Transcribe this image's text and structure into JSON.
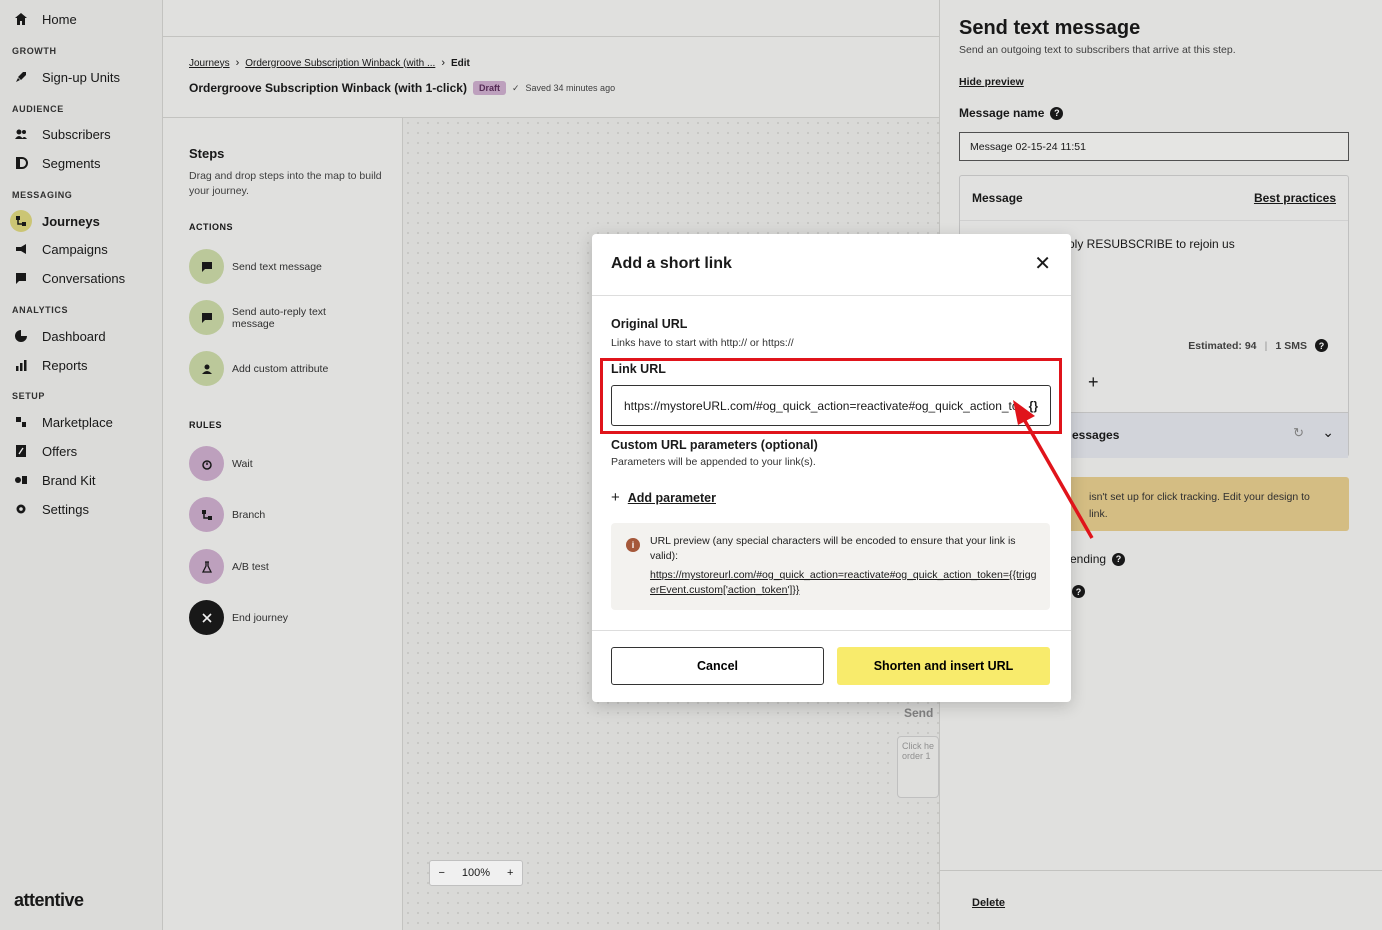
{
  "sidebar": {
    "home": "Home",
    "sections": {
      "growth": "GROWTH",
      "audience": "AUDIENCE",
      "messaging": "MESSAGING",
      "analytics": "ANALYTICS",
      "setup": "SETUP"
    },
    "items": {
      "signup_units": "Sign-up Units",
      "subscribers": "Subscribers",
      "segments": "Segments",
      "journeys": "Journeys",
      "campaigns": "Campaigns",
      "conversations": "Conversations",
      "dashboard": "Dashboard",
      "reports": "Reports",
      "marketplace": "Marketplace",
      "offers": "Offers",
      "brand_kit": "Brand Kit",
      "settings": "Settings"
    },
    "logo": "attentive"
  },
  "header": {
    "crumb_journeys": "Journeys",
    "crumb_journey": "Ordergroove Subscription Winback (with ...",
    "crumb_current": "Edit",
    "title": "Ordergroove Subscription Winback (with 1-click)",
    "badge": "Draft",
    "saved": "Saved 34 minutes ago"
  },
  "steps": {
    "title": "Steps",
    "description": "Drag and drop steps into the map to build your journey.",
    "actions_label": "ACTIONS",
    "rules_label": "RULES",
    "actions": [
      "Send text message",
      "Send auto-reply text message",
      "Add custom attribute"
    ],
    "rules": [
      "Wait",
      "Branch",
      "A/B test",
      "End journey"
    ]
  },
  "canvas": {
    "zoom": "100%",
    "ghost_send": "Send",
    "ghost_text": "Click he order 1"
  },
  "right_panel": {
    "title": "Send text message",
    "subtitle": "Send an outgoing text to subscribers that arrive at this step.",
    "hide_preview": "Hide preview",
    "message_name_label": "Message name",
    "message_name_value": "Message 02-15-24 11:51",
    "message_label": "Message",
    "best_practices": "Best practices",
    "message_body": "ply RESUBSCRIBE to rejoin us",
    "estimated": "Estimated: 94",
    "sms_count": "1 SMS",
    "strip_label": "essages",
    "warning_line1": "isn't set up for click tracking. Edit your design to",
    "warning_line2": "link.",
    "pending": "ending",
    "delete": "Delete"
  },
  "modal": {
    "title": "Add a short link",
    "original_url_label": "Original URL",
    "original_url_hint": "Links have to start with http:// or https://",
    "link_url_label": "Link URL",
    "link_url_value": "https://mystoreURL.com/#og_quick_action=reactivate#og_quick_action_token={{triggerEvent.custom['action_token']}}",
    "variable_button": "{}",
    "custom_params_label": "Custom URL parameters (optional)",
    "custom_params_hint": "Parameters will be appended to your link(s).",
    "add_parameter": "Add parameter",
    "preview_text": "URL preview (any special characters will be encoded to ensure that your link is valid):",
    "preview_url": "https://mystoreurl.com/#og_quick_action=reactivate#og_quick_action_token={{triggerEvent.custom['action_token']}}",
    "cancel": "Cancel",
    "submit": "Shorten and insert URL"
  },
  "colors": {
    "accent_yellow": "#f8eb6c",
    "highlight_red": "#e0141b",
    "draft_badge": "#c9aac9"
  }
}
